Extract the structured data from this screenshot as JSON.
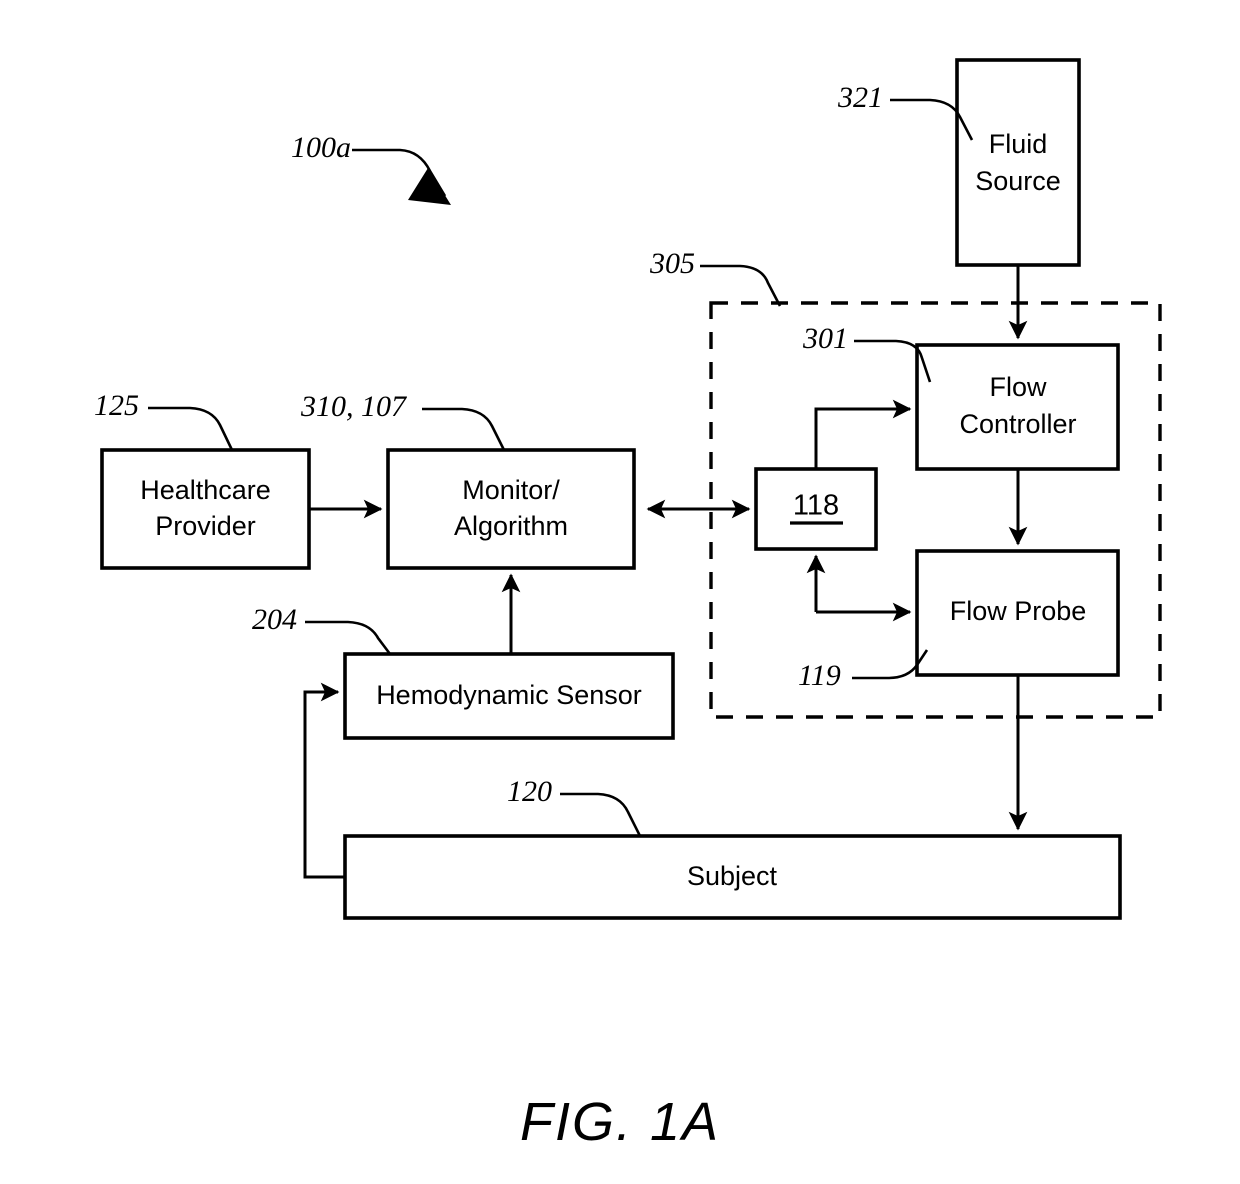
{
  "figure": {
    "caption": "FIG. 1A",
    "system_ref": "100a"
  },
  "nodes": [
    {
      "id": "healthcare-provider",
      "label_lines": [
        "Healthcare",
        "Provider"
      ],
      "ref": "125"
    },
    {
      "id": "monitor-algorithm",
      "label_lines": [
        "Monitor/",
        "Algorithm"
      ],
      "ref": "310, 107"
    },
    {
      "id": "hemodynamic-sensor",
      "label_lines": [
        "Hemodynamic Sensor"
      ],
      "ref": "204"
    },
    {
      "id": "subject",
      "label_lines": [
        "Subject"
      ],
      "ref": "120"
    },
    {
      "id": "fluid-source",
      "label_lines": [
        "Fluid",
        "Source"
      ],
      "ref": "321"
    },
    {
      "id": "flow-controller",
      "label_lines": [
        "Flow",
        "Controller"
      ],
      "ref": "301"
    },
    {
      "id": "flow-probe",
      "label_lines": [
        "Flow Probe"
      ],
      "ref": "119"
    },
    {
      "id": "interface-118",
      "label_lines": [
        "118"
      ],
      "ref": ""
    }
  ],
  "groups": [
    {
      "id": "infusion-assembly",
      "ref": "305",
      "style": "dashed"
    }
  ],
  "colors": {
    "stroke": "#000000",
    "background": "#ffffff"
  }
}
